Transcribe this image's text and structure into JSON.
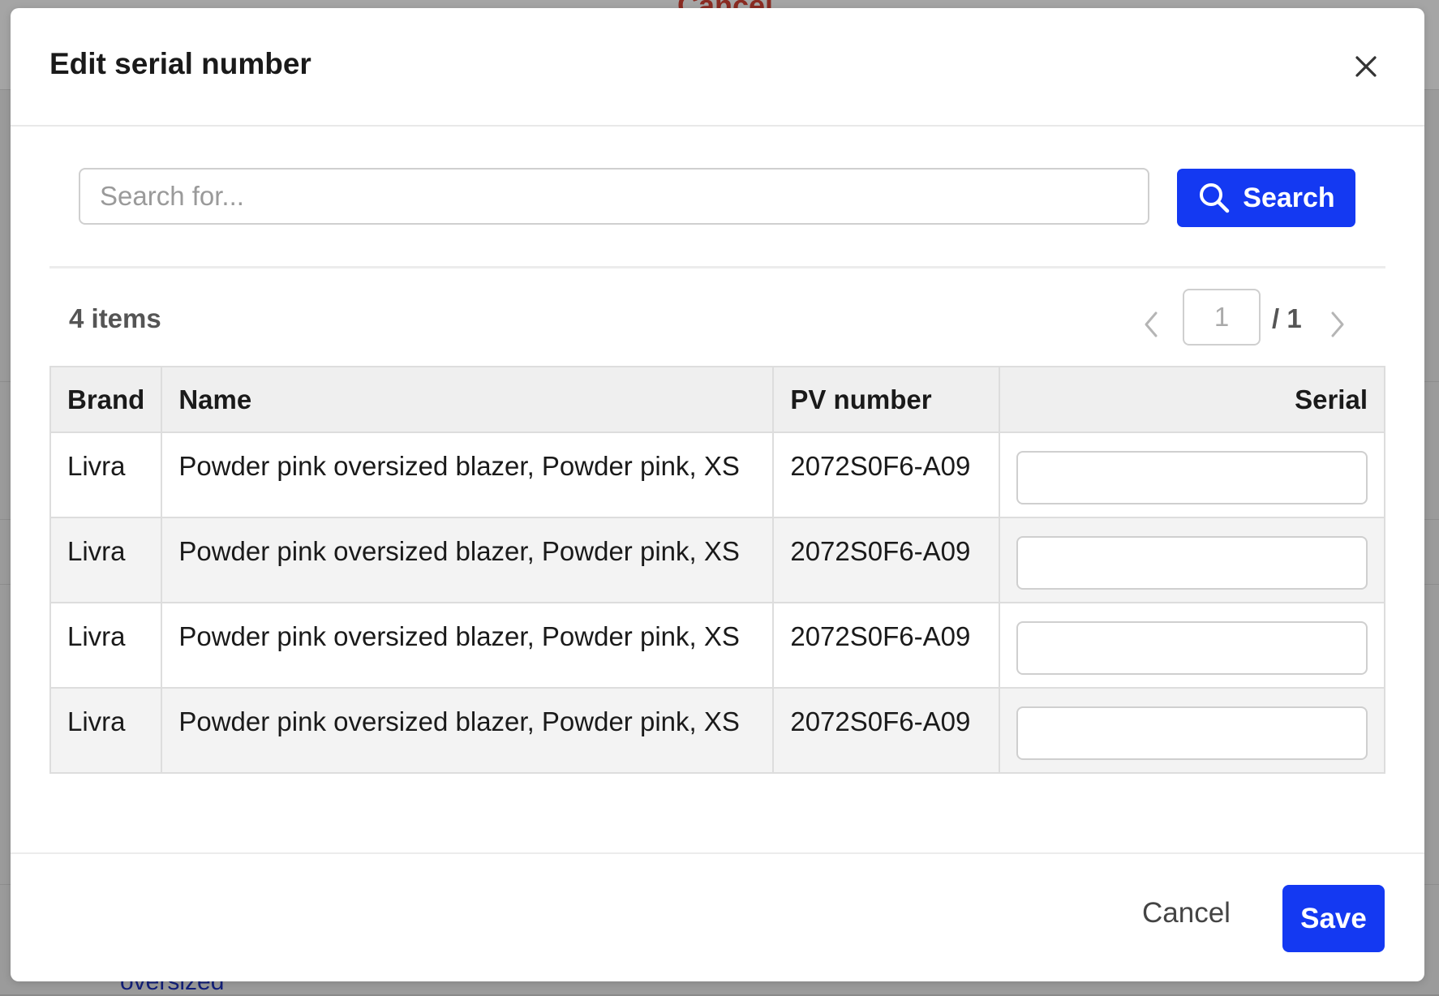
{
  "background": {
    "top_text": "Cancel",
    "bottom_link": "oversized"
  },
  "modal": {
    "title": "Edit serial number",
    "search": {
      "placeholder": "Search for...",
      "button_label": "Search"
    },
    "results": {
      "count_label": "4 items",
      "pagination": {
        "current_page": "1",
        "total_label": "/ 1"
      }
    },
    "table": {
      "headers": [
        "Brand",
        "Name",
        "PV number",
        "Serial"
      ],
      "rows": [
        {
          "brand": "Livra",
          "name": "Powder pink oversized blazer, Powder pink, XS",
          "pv_number": "2072S0F6-A09",
          "serial": ""
        },
        {
          "brand": "Livra",
          "name": "Powder pink oversized blazer, Powder pink, XS",
          "pv_number": "2072S0F6-A09",
          "serial": ""
        },
        {
          "brand": "Livra",
          "name": "Powder pink oversized blazer, Powder pink, XS",
          "pv_number": "2072S0F6-A09",
          "serial": ""
        },
        {
          "brand": "Livra",
          "name": "Powder pink oversized blazer, Powder pink, XS",
          "pv_number": "2072S0F6-A09",
          "serial": ""
        }
      ]
    },
    "footer": {
      "cancel_label": "Cancel",
      "save_label": "Save"
    }
  },
  "colors": {
    "primary": "#1439f2",
    "overlay": "#9b9b9b"
  }
}
